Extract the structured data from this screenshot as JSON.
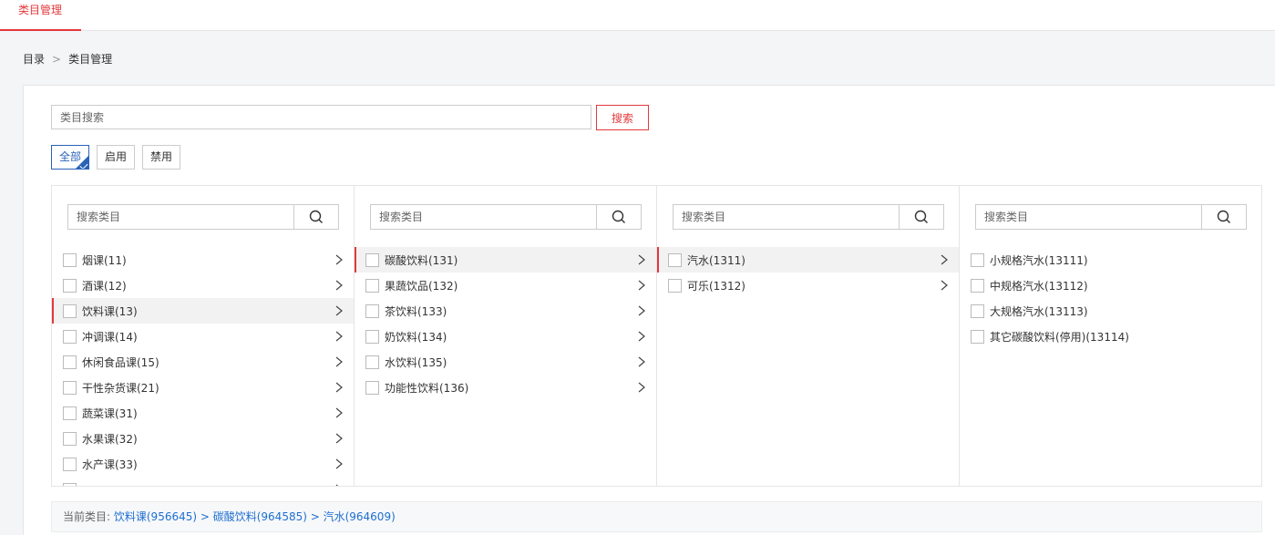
{
  "header": {
    "active_tab": "类目管理"
  },
  "breadcrumb": {
    "root": "目录",
    "separator": ">",
    "current": "类目管理"
  },
  "search": {
    "placeholder": "类目搜索",
    "button_label": "搜索"
  },
  "filters": [
    {
      "label": "全部",
      "active": true
    },
    {
      "label": "启用",
      "active": false
    },
    {
      "label": "禁用",
      "active": false
    }
  ],
  "columns": [
    {
      "search_placeholder": "搜索类目",
      "items": [
        {
          "label": "烟课(11)",
          "has_children": true,
          "selected": false
        },
        {
          "label": "酒课(12)",
          "has_children": true,
          "selected": false
        },
        {
          "label": "饮料课(13)",
          "has_children": true,
          "selected": true
        },
        {
          "label": "冲调课(14)",
          "has_children": true,
          "selected": false
        },
        {
          "label": "休闲食品课(15)",
          "has_children": true,
          "selected": false
        },
        {
          "label": "干性杂货课(21)",
          "has_children": true,
          "selected": false
        },
        {
          "label": "蔬菜课(31)",
          "has_children": true,
          "selected": false
        },
        {
          "label": "水果课(32)",
          "has_children": true,
          "selected": false
        },
        {
          "label": "水产课(33)",
          "has_children": true,
          "selected": false
        },
        {
          "label": "",
          "has_children": true,
          "selected": false
        }
      ]
    },
    {
      "search_placeholder": "搜索类目",
      "items": [
        {
          "label": "碳酸饮料(131)",
          "has_children": true,
          "selected": true
        },
        {
          "label": "果蔬饮品(132)",
          "has_children": true,
          "selected": false
        },
        {
          "label": "茶饮料(133)",
          "has_children": true,
          "selected": false
        },
        {
          "label": "奶饮料(134)",
          "has_children": true,
          "selected": false
        },
        {
          "label": "水饮料(135)",
          "has_children": true,
          "selected": false
        },
        {
          "label": "功能性饮料(136)",
          "has_children": true,
          "selected": false
        }
      ]
    },
    {
      "search_placeholder": "搜索类目",
      "items": [
        {
          "label": "汽水(1311)",
          "has_children": true,
          "selected": true
        },
        {
          "label": "可乐(1312)",
          "has_children": true,
          "selected": false
        }
      ]
    },
    {
      "search_placeholder": "搜索类目",
      "items": [
        {
          "label": "小规格汽水(13111)",
          "has_children": false,
          "selected": false
        },
        {
          "label": "中规格汽水(13112)",
          "has_children": false,
          "selected": false
        },
        {
          "label": "大规格汽水(13113)",
          "has_children": false,
          "selected": false
        },
        {
          "label": "其它碳酸饮料(停用)(13114)",
          "has_children": false,
          "selected": false
        }
      ]
    }
  ],
  "current_path": {
    "label": "当前类目:",
    "value": "饮料课(956645) > 碳酸饮料(964585) > 汽水(964609)"
  },
  "colors": {
    "accent": "#e4393c",
    "link": "#1e6fd0",
    "filter_active": "#2a63b8"
  },
  "icons": {
    "search": "search-icon",
    "chevron": "chevron-right-icon",
    "check": "check-icon"
  }
}
